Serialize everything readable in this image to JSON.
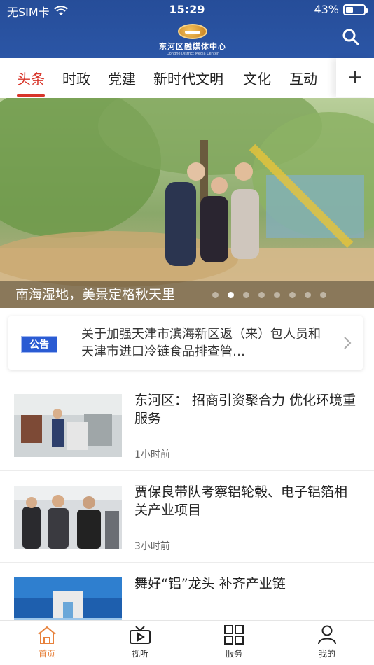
{
  "status_bar": {
    "carrier": "无SIM卡",
    "time": "15:29",
    "battery": "43%",
    "battery_level": 0.43
  },
  "header": {
    "logo_name": "东河区融媒体中心",
    "logo_sub": "Donghe District Media Center"
  },
  "tabs": [
    {
      "label": "头条",
      "active": true
    },
    {
      "label": "时政"
    },
    {
      "label": "党建"
    },
    {
      "label": "新时代文明"
    },
    {
      "label": "文化"
    },
    {
      "label": "互动"
    }
  ],
  "tab_more": "+",
  "banner": {
    "caption": "南海湿地，美景定格秋天里",
    "slide_count": 8,
    "active_slide": 2
  },
  "notice": {
    "badge": "公告",
    "text": "关于加强天津市滨海新区返（来）包人员和天津市进口冷链食品排查管…"
  },
  "news": [
    {
      "title": "东河区： 招商引资聚合力 优化环境重服务",
      "time": "1小时前"
    },
    {
      "title": "贾保良带队考察铝轮毂、电子铝箔相关产业项目",
      "time": "3小时前"
    },
    {
      "title": "舞好“铝”龙头 补齐产业链",
      "time": ""
    }
  ],
  "bottom_nav": [
    {
      "label": "首页",
      "icon": "home-icon",
      "active": true
    },
    {
      "label": "视听",
      "icon": "tv-icon"
    },
    {
      "label": "服务",
      "icon": "grid-icon"
    },
    {
      "label": "我的",
      "icon": "user-icon"
    }
  ],
  "colors": {
    "brand_blue": "#2b56a6",
    "accent_red": "#d8352a",
    "active_orange": "#e7813b",
    "notice_blue": "#2a5bd3"
  }
}
